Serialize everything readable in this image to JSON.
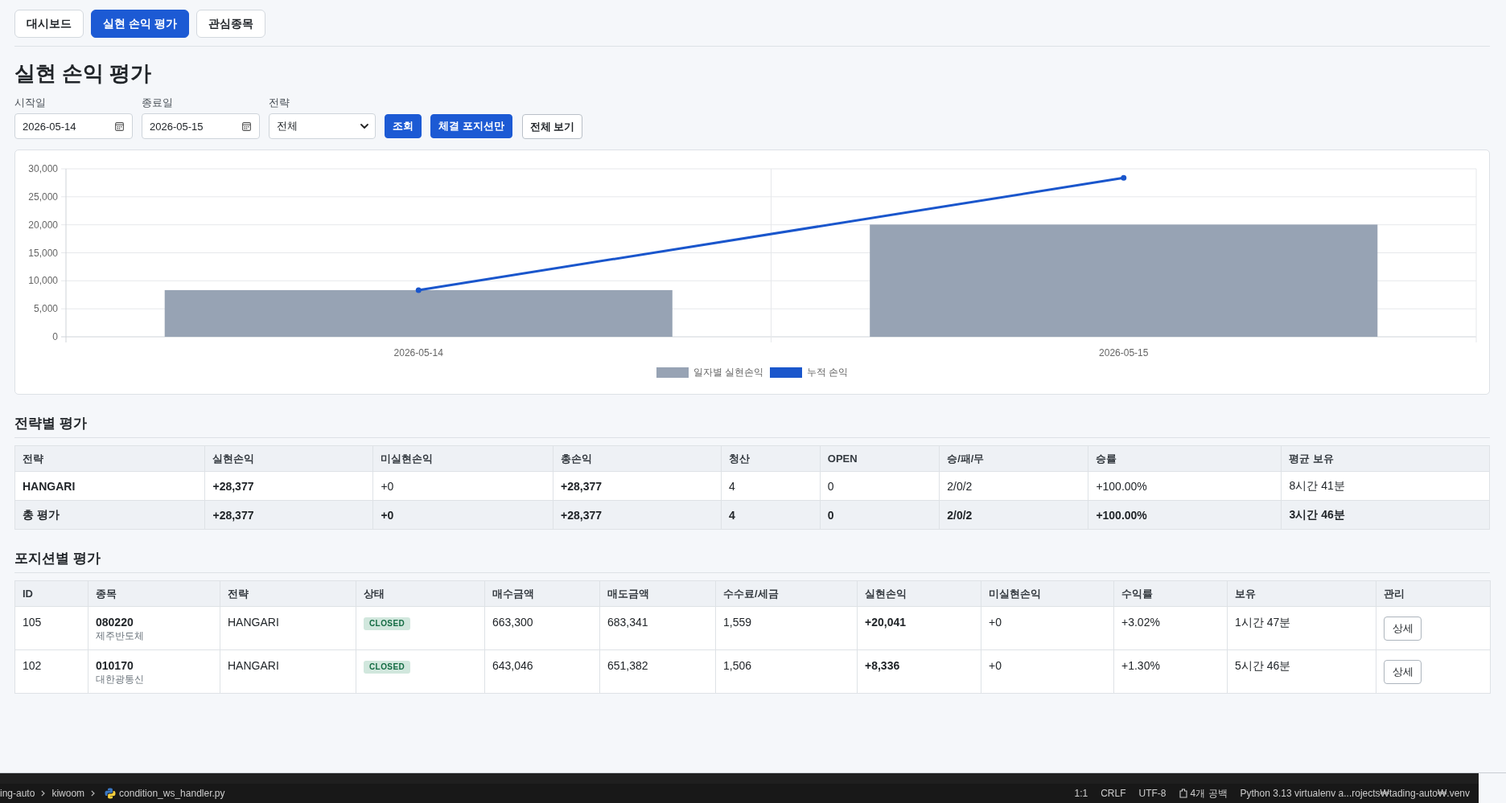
{
  "tabs": [
    {
      "label": "대시보드",
      "selected": false
    },
    {
      "label": "실현 손익 평가",
      "selected": true
    },
    {
      "label": "관심종목",
      "selected": false
    }
  ],
  "page_title": "실현 손익 평가",
  "filters": {
    "fields": [
      {
        "kind": "date",
        "label": "시작일",
        "value": "2026-05-14"
      },
      {
        "kind": "date",
        "label": "종료일",
        "value": "2026-05-15"
      },
      {
        "kind": "select",
        "label": "전략",
        "value": "전체"
      }
    ],
    "buttons": [
      {
        "label": "조회",
        "kind": "primary"
      },
      {
        "label": "체결 포지션만",
        "kind": "primary"
      },
      {
        "label": "전체 보기",
        "kind": "outline"
      }
    ]
  },
  "chart": {
    "chart_data": {
      "type": "bar",
      "categories": [
        "2026-05-14",
        "2026-05-15"
      ],
      "series": [
        {
          "name": "일자별 실현손익",
          "type": "bar",
          "color": "#97a3b4",
          "values": [
            8336,
            20041
          ]
        },
        {
          "name": "누적 손익",
          "type": "line",
          "color": "#1a56cc",
          "marker": "circle",
          "values": [
            8336,
            28377
          ]
        }
      ],
      "ylim": [
        0,
        30000
      ],
      "yticks": [
        0,
        {
          "value": 5000,
          "label": "5,000"
        },
        {
          "value": 10000,
          "label": "10,000"
        },
        {
          "value": 15000,
          "label": "15,000"
        },
        {
          "value": 20000,
          "label": "20,000"
        },
        {
          "value": 25000,
          "label": "25,000"
        },
        {
          "value": 30000,
          "label": "30,000"
        }
      ],
      "stacked": false,
      "grid": true,
      "legend": "bottom"
    }
  },
  "strategy_evaluation": {
    "title": "전략별 평가",
    "columns": [
      {
        "label": "전략",
        "kind": "name"
      },
      {
        "label": "실현손익",
        "kind": "profit"
      },
      {
        "label": "미실현손익",
        "kind": "text"
      },
      {
        "label": "총손익",
        "kind": "profit"
      },
      {
        "label": "청산",
        "kind": "text"
      },
      {
        "label": "OPEN",
        "kind": "text"
      },
      {
        "label": "승/패/무",
        "kind": "text"
      },
      {
        "label": "승률",
        "kind": "text"
      },
      {
        "label": "평균 보유",
        "kind": "text"
      }
    ],
    "rows": [
      [
        "HANGARI",
        "+28,377",
        "+0",
        "+28,377",
        "4",
        "0",
        "2/0/2",
        "+100.00%",
        "8시간 41분"
      ]
    ],
    "total_row": [
      "총 평가",
      "+28,377",
      "+0",
      "+28,377",
      "4",
      "0",
      "2/0/2",
      "+100.00%",
      "3시간 46분"
    ]
  },
  "position_evaluation": {
    "title": "포지션별 평가",
    "columns": [
      {
        "label": "ID",
        "kind": "text"
      },
      {
        "label": "종목",
        "kind": "stock"
      },
      {
        "label": "전략",
        "kind": "text"
      },
      {
        "label": "상태",
        "kind": "badge"
      },
      {
        "label": "매수금액",
        "kind": "text"
      },
      {
        "label": "매도금액",
        "kind": "text"
      },
      {
        "label": "수수료/세금",
        "kind": "text"
      },
      {
        "label": "실현손익",
        "kind": "profit"
      },
      {
        "label": "미실현손익",
        "kind": "text"
      },
      {
        "label": "수익률",
        "kind": "text"
      },
      {
        "label": "보유",
        "kind": "text"
      },
      {
        "label": "관리",
        "kind": "button"
      }
    ],
    "rows": [
      [
        "105",
        {
          "code": "080220",
          "name": "제주반도체"
        },
        "HANGARI",
        "CLOSED",
        "663,300",
        "683,341",
        "1,559",
        "+20,041",
        "+0",
        "+3.02%",
        "1시간 47분",
        "상세"
      ],
      [
        "102",
        {
          "code": "010170",
          "name": "대한광통신"
        },
        "HANGARI",
        "CLOSED",
        "643,046",
        "651,382",
        "1,506",
        "+8,336",
        "+0",
        "+1.30%",
        "5시간 46분",
        "상세"
      ]
    ]
  },
  "status_bar": {
    "breadcrumbs": [
      {
        "label": "ing-auto",
        "kind": "folder"
      },
      {
        "label": "kiwoom",
        "kind": "folder"
      },
      {
        "label": "condition_ws_handler.py",
        "kind": "file"
      }
    ],
    "items": [
      {
        "label": "1:1",
        "kind": "plain"
      },
      {
        "label": "CRLF",
        "kind": "plain"
      },
      {
        "label": "UTF-8",
        "kind": "plain"
      },
      {
        "label": "4개 공백",
        "kind": "indent"
      },
      {
        "label": "Python 3.13 virtualenv a...rojects₩tading-auto₩.venv",
        "kind": "plain"
      }
    ]
  }
}
